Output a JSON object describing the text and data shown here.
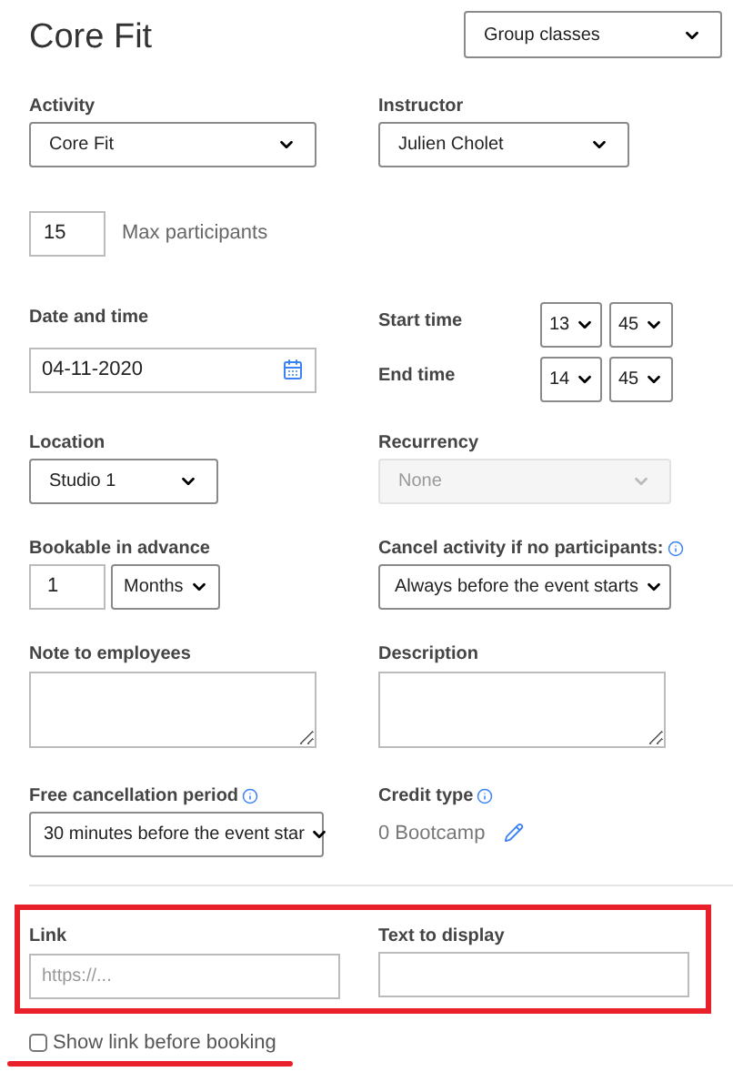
{
  "title": "Core Fit",
  "category_select": {
    "value": "Group classes"
  },
  "activity": {
    "label": "Activity",
    "value": "Core Fit"
  },
  "instructor": {
    "label": "Instructor",
    "value": "Julien Cholet"
  },
  "max_participants": {
    "value": "15",
    "label": "Max participants"
  },
  "date": {
    "label": "Date and time",
    "value": "04-11-2020"
  },
  "start_time": {
    "label": "Start time",
    "hour": "13",
    "minute": "45"
  },
  "end_time": {
    "label": "End time",
    "hour": "14",
    "minute": "45"
  },
  "location": {
    "label": "Location",
    "value": "Studio 1"
  },
  "recurrency": {
    "label": "Recurrency",
    "value": "None",
    "disabled": true
  },
  "bookable": {
    "label": "Bookable in advance",
    "amount": "1",
    "unit": "Months"
  },
  "cancel_activity": {
    "label": "Cancel activity if no participants:",
    "value": "Always before the event starts"
  },
  "note": {
    "label": "Note to employees"
  },
  "description": {
    "label": "Description"
  },
  "free_cancellation": {
    "label": "Free cancellation period",
    "value": "30 minutes before the event star"
  },
  "credit_type": {
    "label": "Credit type",
    "value": "0 Bootcamp"
  },
  "link": {
    "label": "Link",
    "placeholder": "https://..."
  },
  "text_to_display": {
    "label": "Text to display"
  },
  "show_link": {
    "label": "Show link before booking",
    "checked": false
  }
}
